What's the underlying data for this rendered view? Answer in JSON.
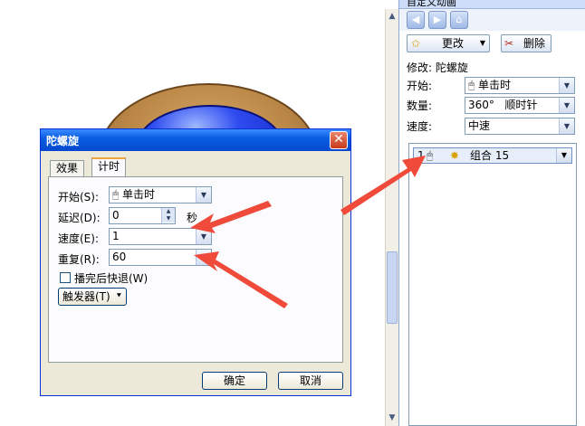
{
  "pane": {
    "title": "自定义动画",
    "change_button": "更改",
    "delete_button": "删除",
    "modify_text": "修改: 陀螺旋",
    "start_label": "开始:",
    "start_value": "单击时",
    "amount_label": "数量:",
    "amount_value": "360°   顺时针",
    "speed_label": "速度:",
    "speed_value": "中速",
    "list_item": {
      "number": "1",
      "label": "组合 15"
    }
  },
  "dialog": {
    "title": "陀螺旋",
    "tabs": [
      "效果",
      "计时"
    ],
    "start_label": "开始(S):",
    "start_value": "单击时",
    "delay_label": "延迟(D):",
    "delay_value": "0",
    "delay_unit": "秒",
    "speed_label": "速度(E):",
    "speed_value": "1",
    "repeat_label": "重复(R):",
    "repeat_value": "60",
    "rewind_label": "播完后快退(W)",
    "triggers_label": "触发器(T)",
    "ok_button": "确定",
    "cancel_button": "取消"
  },
  "colors": {
    "annotation_arrow": "#f04a3a",
    "xp_title_blue": "#0a5ee0",
    "dialog_face": "#ece9d8"
  }
}
